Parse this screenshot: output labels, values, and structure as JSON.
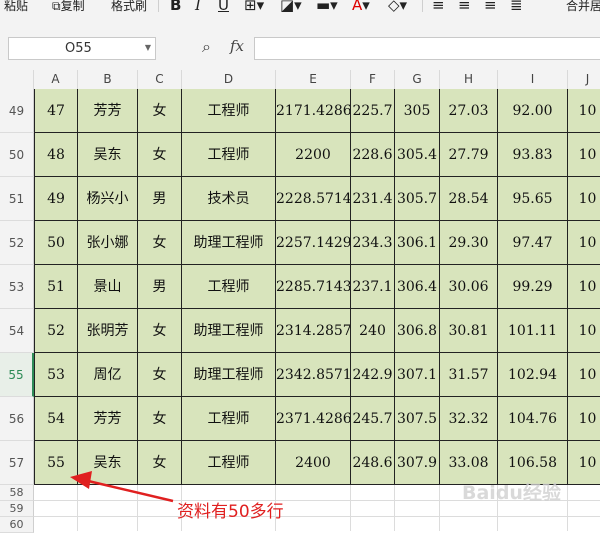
{
  "toolbar": {
    "paste_label": "粘贴",
    "copy_label": "复制",
    "format_painter_label": "格式刷",
    "merge_label": "合并居",
    "bold_icon": "B",
    "italic_icon": "I",
    "underline_icon": "U"
  },
  "formula_bar": {
    "name_box": "O55",
    "fx_label": "fx",
    "formula": ""
  },
  "columns": [
    "A",
    "B",
    "C",
    "D",
    "E",
    "F",
    "G",
    "H",
    "I",
    "J"
  ],
  "rows": [
    {
      "num": "49",
      "cells": [
        "47",
        "芳芳",
        "女",
        "工程师",
        "2171.4286",
        "225.7",
        "305",
        "27.03",
        "92.00",
        "10"
      ]
    },
    {
      "num": "50",
      "cells": [
        "48",
        "吴东",
        "女",
        "工程师",
        "2200",
        "228.6",
        "305.4",
        "27.79",
        "93.83",
        "10"
      ]
    },
    {
      "num": "51",
      "cells": [
        "49",
        "杨兴小",
        "男",
        "技术员",
        "2228.5714",
        "231.4",
        "305.7",
        "28.54",
        "95.65",
        "10"
      ]
    },
    {
      "num": "52",
      "cells": [
        "50",
        "张小娜",
        "女",
        "助理工程师",
        "2257.1429",
        "234.3",
        "306.1",
        "29.30",
        "97.47",
        "10"
      ]
    },
    {
      "num": "53",
      "cells": [
        "51",
        "景山",
        "男",
        "工程师",
        "2285.7143",
        "237.1",
        "306.4",
        "30.06",
        "99.29",
        "10"
      ]
    },
    {
      "num": "54",
      "cells": [
        "52",
        "张明芳",
        "女",
        "助理工程师",
        "2314.2857",
        "240",
        "306.8",
        "30.81",
        "101.11",
        "10"
      ]
    },
    {
      "num": "55",
      "cells": [
        "53",
        "周亿",
        "女",
        "助理工程师",
        "2342.8571",
        "242.9",
        "307.1",
        "31.57",
        "102.94",
        "10"
      ]
    },
    {
      "num": "56",
      "cells": [
        "54",
        "芳芳",
        "女",
        "工程师",
        "2371.4286",
        "245.7",
        "307.5",
        "32.32",
        "104.76",
        "10"
      ]
    },
    {
      "num": "57",
      "cells": [
        "55",
        "吴东",
        "女",
        "工程师",
        "2400",
        "248.6",
        "307.9",
        "33.08",
        "106.58",
        "10"
      ]
    }
  ],
  "empty_rows": [
    "58",
    "59",
    "60"
  ],
  "active_row": "55",
  "annotation": "资料有50多行",
  "watermark": "Baidu经验",
  "colors": {
    "data_fill": "#d8e4bc",
    "annotation": "#e02020",
    "active": "#2e8b57"
  }
}
